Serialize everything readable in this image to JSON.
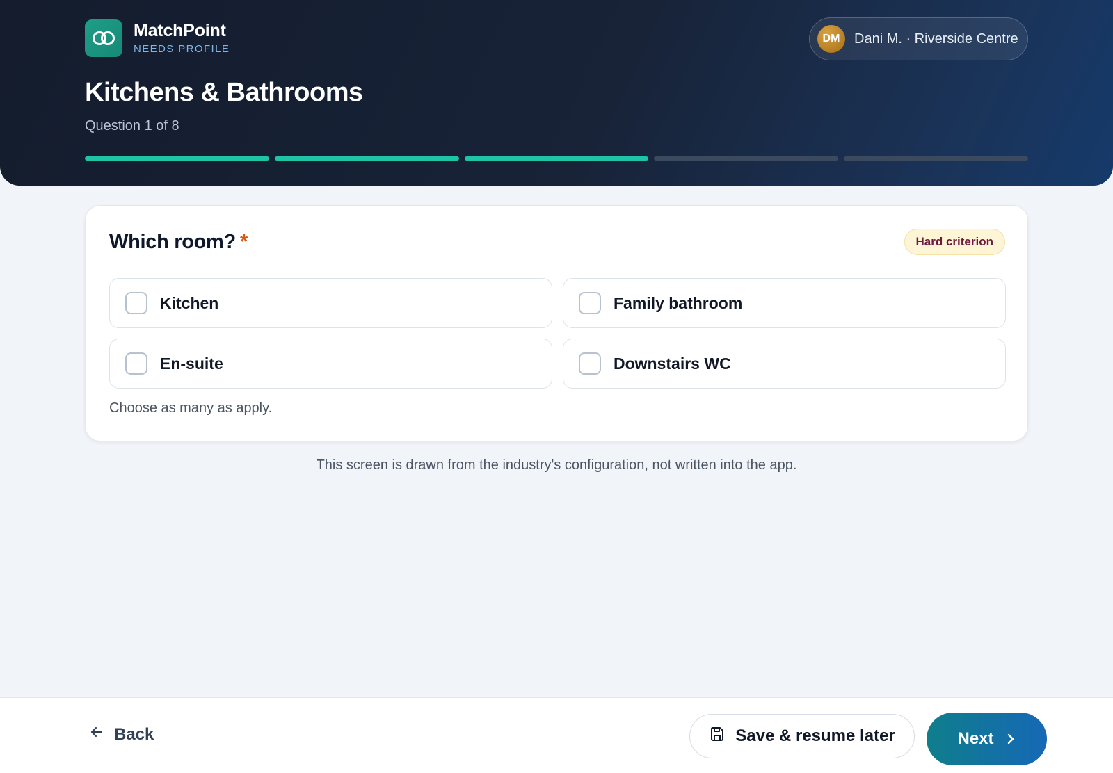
{
  "brand": {
    "name": "MatchPoint",
    "subtitle": "NEEDS PROFILE"
  },
  "user": {
    "initials": "DM",
    "label": "Dani M. · Riverside Centre"
  },
  "header": {
    "title": "Kitchens & Bathrooms",
    "subtitle": "Question 1 of 8"
  },
  "progress": {
    "segments_total": 5,
    "segments_complete": 3
  },
  "question": {
    "title": "Which room?",
    "required_marker": "*",
    "badge": "Hard criterion",
    "options": [
      {
        "label": "Kitchen",
        "checked": false
      },
      {
        "label": "Family bathroom",
        "checked": false
      },
      {
        "label": "En-suite",
        "checked": false
      },
      {
        "label": "Downstairs WC",
        "checked": false
      }
    ],
    "helper": "Choose as many as apply."
  },
  "footnote": "This screen is drawn from the industry's configuration, not written into the app.",
  "actions": {
    "back": "Back",
    "save": "Save & resume later",
    "next": "Next"
  },
  "colors": {
    "accent_teal": "#1fc3a5",
    "required": "#d45a12",
    "badge_bg": "#fdf5d6",
    "badge_text": "#6d1a3b"
  }
}
